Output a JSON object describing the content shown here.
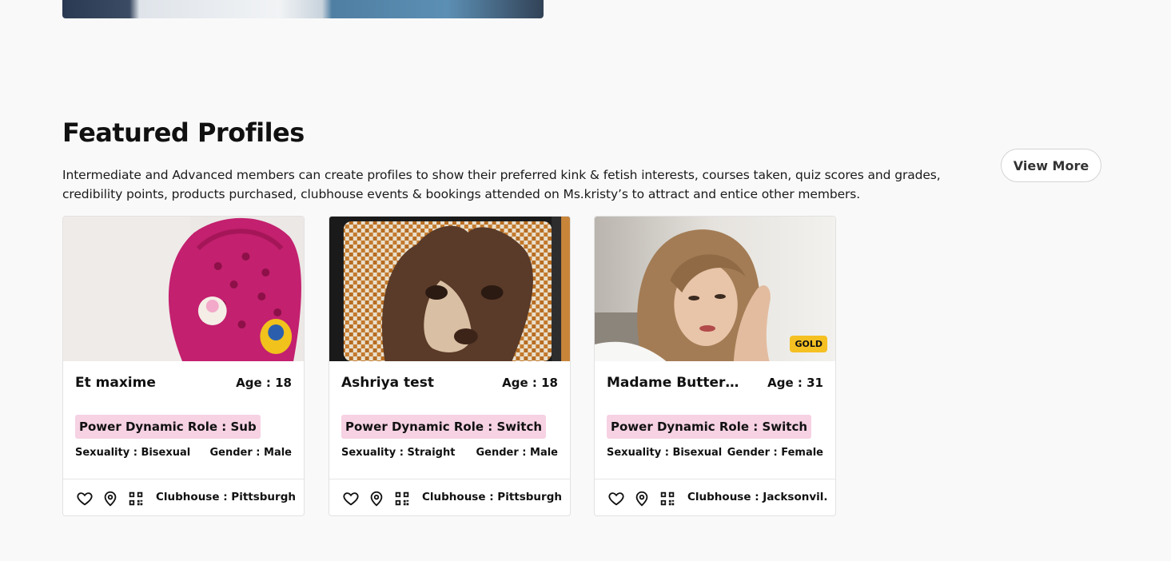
{
  "section": {
    "title": "Featured Profiles",
    "description": "Intermediate and Advanced members can create profiles to show their preferred kink & fetish interests, courses taken, quiz scores and grades, credibility points, products purchased, clubhouse events & bookings attended on Ms.kristy’s to attract and entice other members.",
    "view_more_label": "View More"
  },
  "profiles": [
    {
      "name": "Et maxime",
      "age": "Age : 18",
      "role": "Power Dynamic Role : Sub",
      "sexuality": "Sexuality : Bisexual",
      "gender": "Gender : Male",
      "clubhouse": "Clubhouse : Pittsburgh..",
      "image_subject": "pink clog shoe with charms"
    },
    {
      "name": "Ashriya test",
      "age": "Age : 18",
      "role": "Power Dynamic Role : Switch",
      "sexuality": "Sexuality : Straight",
      "gender": "Gender : Male",
      "clubhouse": "Clubhouse : Pittsburgh..",
      "image_subject": "chihuahua dog"
    },
    {
      "name": "Madame Butterfl...",
      "age": "Age : 31",
      "role": "Power Dynamic Role : Switch",
      "sexuality": "Sexuality : Bisexual",
      "gender": "Gender : Female",
      "clubhouse": "Clubhouse : Jacksonvil..",
      "badge": "GOLD",
      "image_subject": "woman with long hair"
    }
  ],
  "colors": {
    "role_tag": "#f6d2e3",
    "gold_badge": "#f5c021",
    "background": "#f9f9f9"
  },
  "icons": [
    "heart-icon",
    "location-pin-icon",
    "qr-code-icon"
  ]
}
